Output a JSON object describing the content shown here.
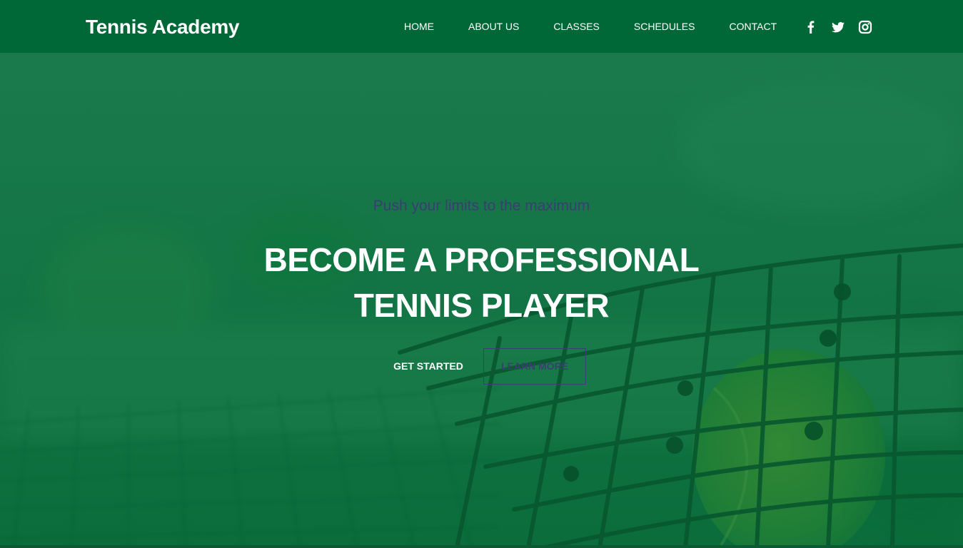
{
  "header": {
    "brand": "Tennis Academy",
    "nav": [
      "HOME",
      "ABOUT US",
      "CLASSES",
      "SCHEDULES",
      "CONTACT"
    ],
    "social_icons": [
      "facebook-icon",
      "twitter-icon",
      "instagram-icon"
    ]
  },
  "hero": {
    "tagline": "Push your limits to the maximum",
    "headline_line1": "BECOME A PROFESSIONAL",
    "headline_line2": "TENNIS PLAYER",
    "primary_button": "GET STARTED",
    "secondary_button": "LEARN MORE",
    "background_image": "tennis net with tennis ball"
  },
  "colors": {
    "brand_green": "#006837",
    "accent_purple": "#3b3d73",
    "text_white": "#ffffff"
  }
}
